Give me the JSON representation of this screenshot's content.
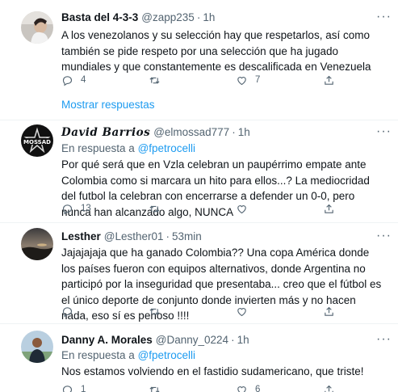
{
  "tweets": [
    {
      "name": "Basta del 4-3-3",
      "handle": "@zapp235",
      "time": "1h",
      "reply_label": "",
      "reply_mention": "",
      "text": "A los venezolanos y su selección hay que respetarlos, así como también se pide respeto por una selección que ha jugado mundiales y que constantemente es descalificada en Venezuela",
      "replies": "4",
      "retweets": "",
      "likes": "7"
    },
    {
      "name": "David Barrios",
      "handle": "@elmossad777",
      "time": "1h",
      "reply_label": "En respuesta a",
      "reply_mention": "@fpetrocelli",
      "text": "Por qué será que en Vzla celebran un paupérrimo empate ante Colombia como si marcara un hito para ellos...? La mediocridad del futbol la celebran con encerrarse a defender un 0-0, pero nunca han alcanzado algo, NUNCA",
      "replies": "13",
      "retweets": "",
      "likes": ""
    },
    {
      "name": "Lesther",
      "handle": "@Lesther01",
      "time": "53min",
      "reply_label": "",
      "reply_mention": "",
      "text": "Jajajajaja que ha ganado Colombia?? Una copa América donde los países fueron con equipos alternativos, donde Argentina no participó por la inseguridad que presentaba... creo que el fútbol es el único deporte de conjunto donde invierten más y no hacen nada, eso sí es penoso !!!!",
      "replies": "",
      "retweets": "",
      "likes": ""
    },
    {
      "name": "Danny A. Morales",
      "handle": "@Danny_0224",
      "time": "1h",
      "reply_label": "En respuesta a",
      "reply_mention": "@fpetrocelli",
      "text": "Nos estamos volviendo en el fastidio sudamericano, que triste!",
      "replies": "1",
      "retweets": "",
      "likes": "6"
    }
  ],
  "show_replies": "Mostrar respuestas",
  "separator": "·",
  "more_glyph": "···",
  "icons": {
    "reply": "reply-icon",
    "retweet": "retweet-icon",
    "like": "heart-icon",
    "share": "share-icon",
    "more": "more-icon"
  },
  "colors": {
    "link": "#1d9bf0",
    "secondary": "#536471",
    "text": "#0f1419",
    "divider": "#eff3f4"
  }
}
